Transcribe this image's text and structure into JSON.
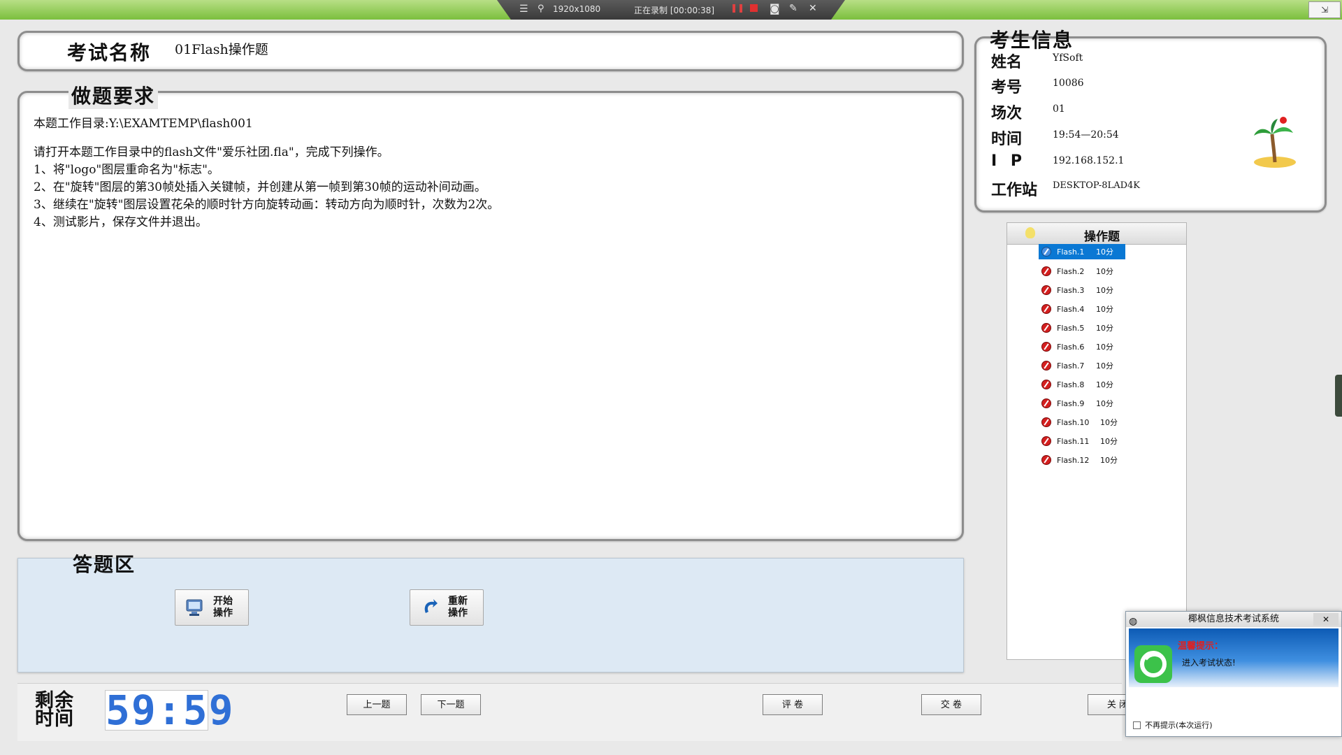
{
  "recorder": {
    "resolution": "1920x1080",
    "status": "正在录制 [00:00:38]"
  },
  "exam": {
    "name_label": "考试名称",
    "name_value": "01Flash操作题"
  },
  "requirements": {
    "heading": "做题要求",
    "lines": [
      "本题工作目录:Y:\\EXAMTEMP\\flash001",
      "请打开本题工作目录中的flash文件\"爱乐社团.fla\"，完成下列操作。",
      "1、将\"logo\"图层重命名为\"标志\"。",
      "2、在\"旋转\"图层的第30帧处插入关键帧，并创建从第一帧到第30帧的运动补间动画。",
      "3、继续在\"旋转\"图层设置花朵的顺时针方向旋转动画：转动方向为顺时针，次数为2次。",
      "4、测试影片，保存文件并退出。"
    ]
  },
  "answer": {
    "heading": "答题区",
    "start_label": "开始操作",
    "reset_label": "重新操作"
  },
  "timer": {
    "label": "剩余时间",
    "value": "59:59"
  },
  "nav": {
    "prev": "上一题",
    "next": "下一题",
    "grade": "评 卷",
    "submit": "交 卷",
    "close": "关 闭"
  },
  "candidate": {
    "heading": "考生信息",
    "name_label": "姓名",
    "name_value": "YfSoft",
    "id_label": "考号",
    "id_value": "10086",
    "session_label": "场次",
    "session_value": "01",
    "time_label": "时间",
    "time_value": "19:54—20:54",
    "ip_label": "I P",
    "ip_value": "192.168.152.1",
    "station_label": "工作站",
    "station_value": "DESKTOP-8LAD4K"
  },
  "questions": {
    "header": "操作题",
    "items": [
      {
        "name": "Flash.1",
        "score": "10分"
      },
      {
        "name": "Flash.2",
        "score": "10分"
      },
      {
        "name": "Flash.3",
        "score": "10分"
      },
      {
        "name": "Flash.4",
        "score": "10分"
      },
      {
        "name": "Flash.5",
        "score": "10分"
      },
      {
        "name": "Flash.6",
        "score": "10分"
      },
      {
        "name": "Flash.7",
        "score": "10分"
      },
      {
        "name": "Flash.8",
        "score": "10分"
      },
      {
        "name": "Flash.9",
        "score": "10分"
      },
      {
        "name": "Flash.10",
        "score": "10分"
      },
      {
        "name": "Flash.11",
        "score": "10分"
      },
      {
        "name": "Flash.12",
        "score": "10分"
      }
    ]
  },
  "toast": {
    "title": "椰枫信息技术考试系统",
    "warn": "温馨提示：",
    "message": "进入考试状态!",
    "checkbox_label": "不再提示(本次运行)"
  },
  "colors": {
    "accent": "#0a78d4",
    "timer_digits": "#2f6fd6",
    "answer_bg": "#dde9f4",
    "warn_text": "#e02020"
  }
}
